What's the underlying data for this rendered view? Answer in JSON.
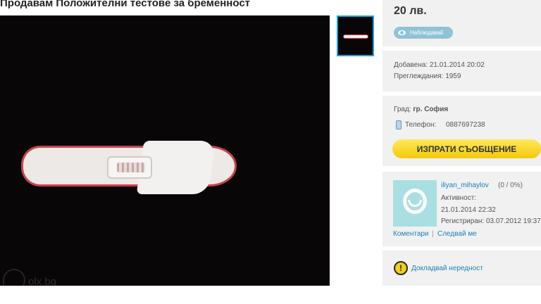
{
  "listing": {
    "title": "Продавам Положителни тестове за бременност"
  },
  "photo": {
    "watermark_text": "olx.bg"
  },
  "price": {
    "amount": "20 лв.",
    "watch_label": "Наблюдавай"
  },
  "stats": {
    "added": "Добавена: 21.01.2014 20:02",
    "views": "Преглеждания: 1959"
  },
  "contact": {
    "city_label": "Град:",
    "city": "гр. София",
    "phone_label": "Телефон:",
    "phone": "0887697238",
    "send_button": "ИЗПРАТИ СЪОБЩЕНИЕ"
  },
  "user": {
    "name": "iliyan_mihaylov",
    "rating": "(0 / 0%)",
    "activity_label": "Активност:",
    "activity_time": "21.01.2014 22:32",
    "registered": "Регистриран: 03.07.2012 19:37",
    "comments_link": "Коментари",
    "follow_link": "Следвай ме",
    "separator": "|"
  },
  "report": {
    "label": "Докладвай нередност"
  },
  "colors": {
    "accent_blue": "#19a3d6",
    "button_yellow": "#f3c90c",
    "panel_bg": "#f1f1f1"
  }
}
